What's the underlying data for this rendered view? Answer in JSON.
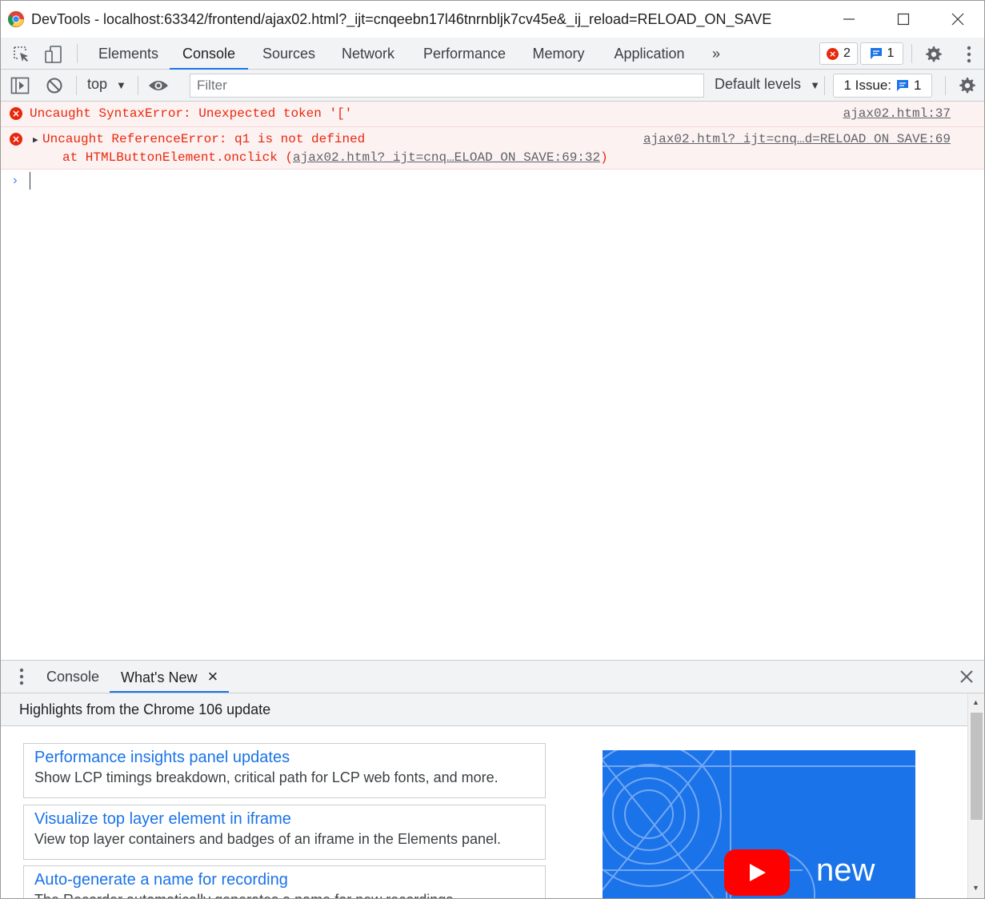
{
  "window": {
    "title": "DevTools - localhost:63342/frontend/ajax02.html?_ijt=cnqeebn17l46tnrnbljk7cv45e&_ij_reload=RELOAD_ON_SAVE",
    "minimize_icon": "minimize-icon",
    "maximize_icon": "maximize-icon",
    "close_icon": "close-icon"
  },
  "tabs": {
    "items": [
      {
        "label": "Elements"
      },
      {
        "label": "Console"
      },
      {
        "label": "Sources"
      },
      {
        "label": "Network"
      },
      {
        "label": "Performance"
      },
      {
        "label": "Memory"
      },
      {
        "label": "Application"
      }
    ],
    "active": "Console",
    "more": "»",
    "error_count": "2",
    "message_count": "1"
  },
  "console_toolbar": {
    "context": "top",
    "filter_placeholder": "Filter",
    "levels": "Default levels",
    "issues_label": "1 Issue:",
    "issues_count": "1"
  },
  "messages": [
    {
      "text": "Uncaught SyntaxError: Unexpected token '['",
      "source": "ajax02.html:37"
    },
    {
      "text": "Uncaught ReferenceError: q1 is not defined",
      "source": "ajax02.html?_ijt=cnq…d=RELOAD_ON_SAVE:69",
      "stack_prefix": "at HTMLButtonElement.onclick (",
      "stack_link": "ajax02.html?_ijt=cnq…ELOAD_ON_SAVE:69:32",
      "stack_suffix": ")"
    }
  ],
  "prompt": "›",
  "drawer": {
    "tabs": [
      {
        "label": "Console"
      },
      {
        "label": "What's New"
      }
    ],
    "close_tab": "×",
    "highlights": "Highlights from the Chrome 106 update",
    "cards": [
      {
        "title": "Performance insights panel updates",
        "desc": "Show LCP timings breakdown, critical path for LCP web fonts, and more."
      },
      {
        "title": "Visualize top layer element in iframe",
        "desc": "View top layer containers and badges of an iframe in the Elements panel."
      },
      {
        "title": "Auto-generate a name for recording",
        "desc": "The Recorder automatically generates a name for new recordings."
      }
    ],
    "video_text": "new"
  },
  "colors": {
    "error": "#e8280c",
    "accent": "#1a73e8",
    "toolbar_bg": "#f1f3f4"
  }
}
